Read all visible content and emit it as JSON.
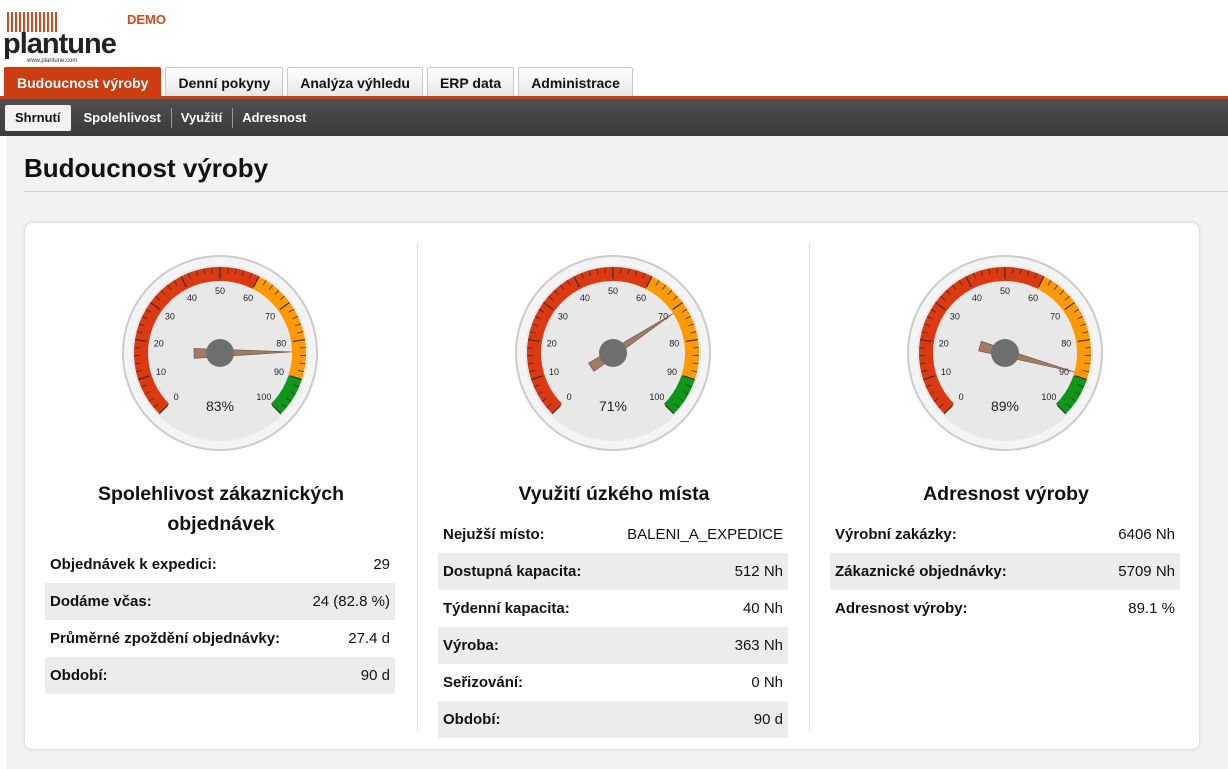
{
  "brand": {
    "logo_text": "plantune",
    "logo_url": "www.plantune.com",
    "demo_label": "DEMO",
    "accent": "#cc3d12"
  },
  "main_tabs": [
    {
      "label": "Budoucnost výroby",
      "active": true
    },
    {
      "label": "Denní pokyny",
      "active": false
    },
    {
      "label": "Analýza výhledu",
      "active": false
    },
    {
      "label": "ERP data",
      "active": false
    },
    {
      "label": "Administrace",
      "active": false
    }
  ],
  "sub_tabs": [
    {
      "label": "Shrnutí",
      "active": true
    },
    {
      "label": "Spolehlivost",
      "active": false
    },
    {
      "label": "Využití",
      "active": false
    },
    {
      "label": "Adresnost",
      "active": false
    }
  ],
  "page_title": "Budoucnost výroby",
  "gauge_scale": {
    "min": 0,
    "max": 100,
    "tick_labels": [
      "0",
      "10",
      "20",
      "30",
      "40",
      "50",
      "60",
      "70",
      "80",
      "90",
      "100"
    ],
    "bands": [
      {
        "from": 0,
        "to": 60,
        "color": "#dc3912"
      },
      {
        "from": 60,
        "to": 90,
        "color": "#ff9900"
      },
      {
        "from": 90,
        "to": 100,
        "color": "#109618"
      }
    ],
    "needle_color": "#a07c66",
    "hub_color": "#6e6e6e"
  },
  "panels": [
    {
      "title_line1": "Spolehlivost zákaznických",
      "title_line2": "objednávek",
      "gauge": {
        "value": 83,
        "label": "83%"
      },
      "rows": [
        {
          "label": "Objednávek k expedici:",
          "value": "29"
        },
        {
          "label": "Dodáme včas:",
          "value": "24 (82.8 %)"
        },
        {
          "label": "Průměrné zpoždění objednávky:",
          "value": "27.4 d"
        },
        {
          "label": "Období:",
          "value": "90 d"
        }
      ]
    },
    {
      "title_line1": "Využití úzkého místa",
      "title_line2": "",
      "gauge": {
        "value": 71,
        "label": "71%"
      },
      "rows": [
        {
          "label": "Nejužší místo:",
          "value": "BALENI_A_EXPEDICE"
        },
        {
          "label": "Dostupná kapacita:",
          "value": "512 Nh"
        },
        {
          "label": "Týdenní kapacita:",
          "value": "40 Nh"
        },
        {
          "label": "Výroba:",
          "value": "363 Nh"
        },
        {
          "label": "Seřizování:",
          "value": "0 Nh"
        },
        {
          "label": "Období:",
          "value": "90 d"
        }
      ]
    },
    {
      "title_line1": "Adresnost výroby",
      "title_line2": "",
      "gauge": {
        "value": 89,
        "label": "89%"
      },
      "rows": [
        {
          "label": "Výrobní zakázky:",
          "value": "6406 Nh"
        },
        {
          "label": "Zákaznické objednávky:",
          "value": "5709 Nh"
        },
        {
          "label": "Adresnost výroby:",
          "value": "89.1 %"
        }
      ]
    }
  ]
}
